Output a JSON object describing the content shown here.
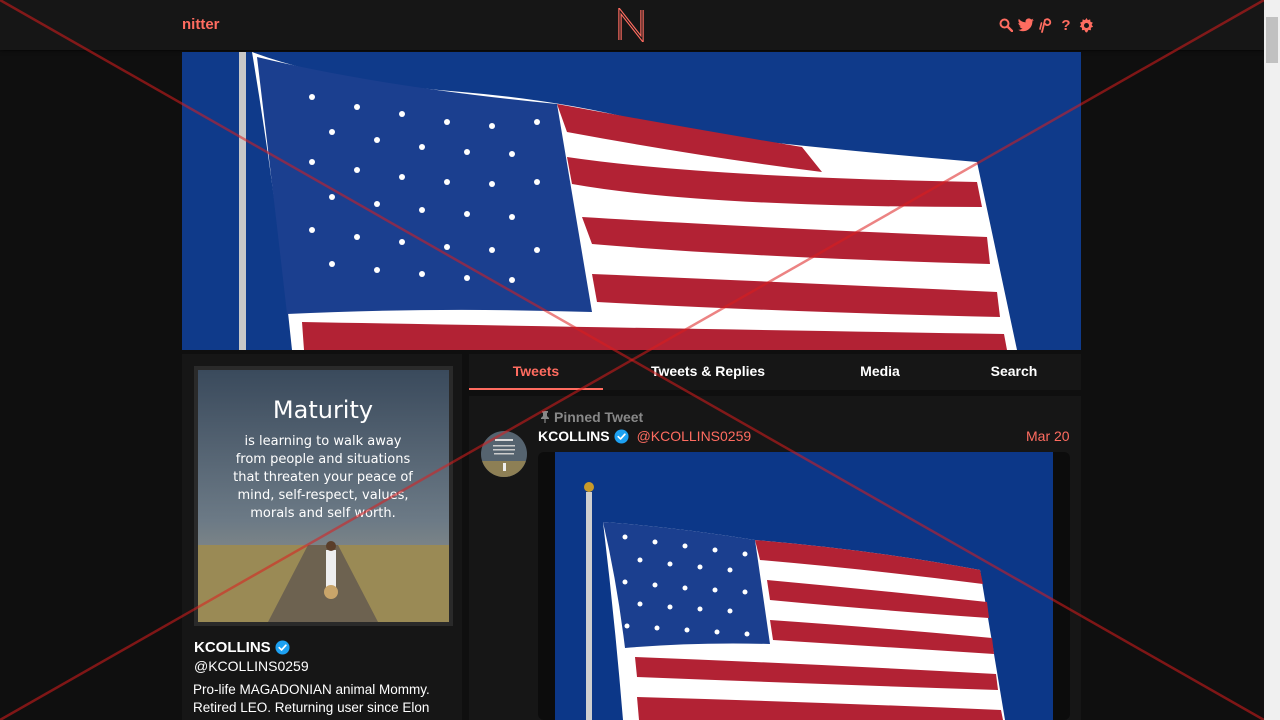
{
  "navbar": {
    "brand": "nitter",
    "logo_letter": "N",
    "icons": [
      "search-icon",
      "twitter-bird-icon",
      "rss-icon",
      "help-icon",
      "gear-icon"
    ],
    "help_glyph": "?"
  },
  "banner": {
    "image": "waving-american-flag"
  },
  "profile": {
    "avatar_title": "Maturity",
    "avatar_text": [
      "is learning to walk away",
      "from people and situations",
      "that threaten your peace of",
      "mind, self-respect, values,",
      "morals and self worth."
    ],
    "fullname": "KCOLLINS",
    "verified": true,
    "username": "@KCOLLINS0259",
    "bio_lines": [
      "Pro-life MAGADONIAN animal Mommy.",
      "Retired LEO. Returning user since Elon"
    ]
  },
  "tabs": [
    {
      "label": "Tweets",
      "active": true
    },
    {
      "label": "Tweets & Replies",
      "active": false
    },
    {
      "label": "Media",
      "active": false
    },
    {
      "label": "Search",
      "active": false
    }
  ],
  "tweet": {
    "pinned_label": "Pinned Tweet",
    "fullname": "KCOLLINS",
    "username": "@KCOLLINS0259",
    "date": "Mar 20",
    "media": "waving-american-flag"
  },
  "colors": {
    "accent": "#ff6c60",
    "background": "#0f0f0f",
    "panel": "#161616",
    "verified": "#1da1f2",
    "flag_blue": "#0f3a8a",
    "flag_red": "#b22234"
  }
}
